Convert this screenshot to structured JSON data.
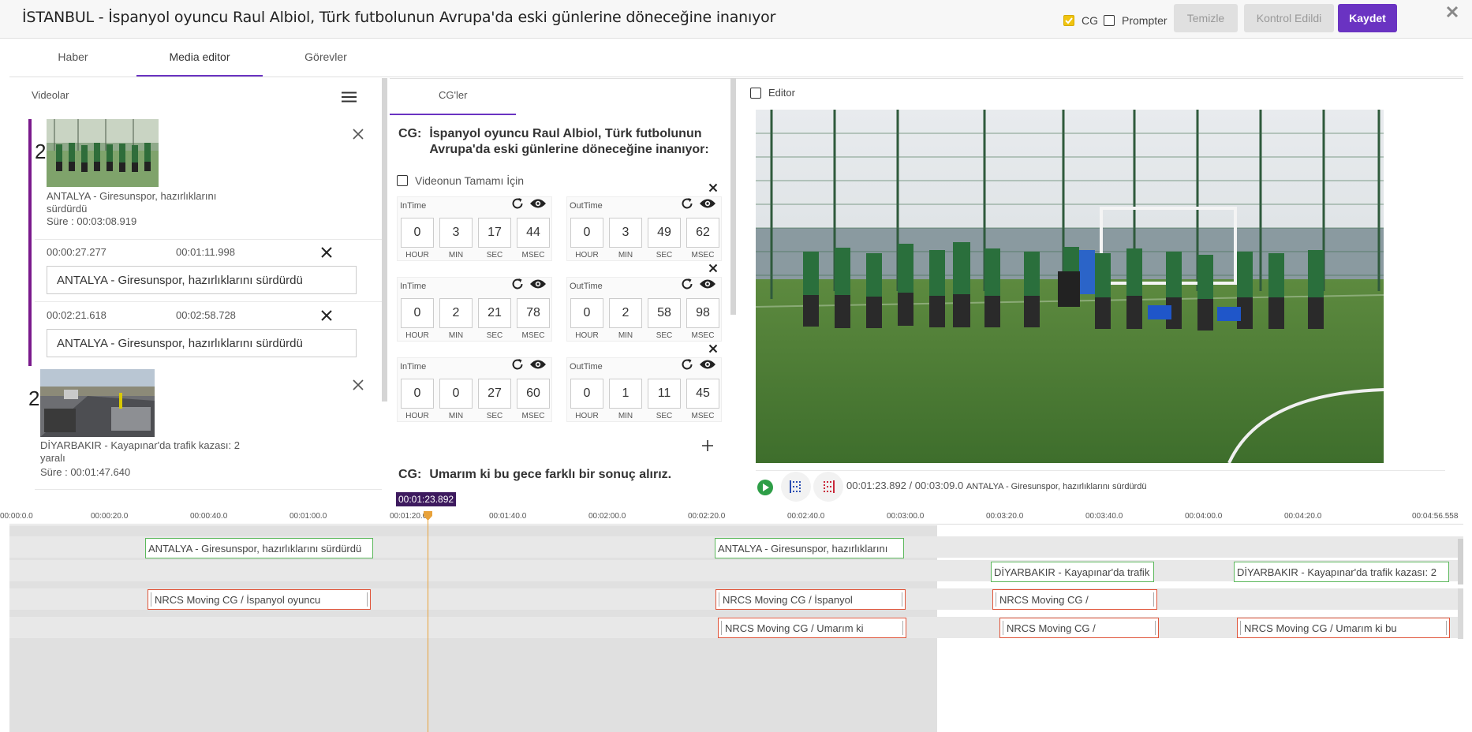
{
  "header": {
    "title": "İSTANBUL - İspanyol oyuncu Raul Albiol, Türk futbolunun Avrupa'da eski günlerine döneceğine inanıyor",
    "cg_label": "CG",
    "prompter_label": "Prompter",
    "clear_label": "Temizle",
    "checked_label": "Kontrol Edildi",
    "save_label": "Kaydet",
    "cg_checked": true,
    "prompter_checked": false
  },
  "tabs": [
    {
      "label": "Haber",
      "active": false
    },
    {
      "label": "Media editor",
      "active": true
    },
    {
      "label": "Görevler",
      "active": false
    }
  ],
  "videos_panel": {
    "title": "Videolar",
    "videos": [
      {
        "index": "2",
        "title": "ANTALYA - Giresunspor, hazırlıklarını sürdürdü",
        "duration_label": "Süre :",
        "duration": "00:03:08.919",
        "segments": [
          {
            "start": "00:00:27.277",
            "end": "00:01:11.998",
            "text": "ANTALYA - Giresunspor, hazırlıklarını sürdürdü"
          },
          {
            "start": "00:02:21.618",
            "end": "00:02:58.728",
            "text": "ANTALYA - Giresunspor, hazırlıklarını sürdürdü"
          }
        ]
      },
      {
        "index": "2",
        "title": "DİYARBAKIR - Kayapınar'da trafik kazası: 2 yaralı",
        "duration_label": "Süre :",
        "duration": "00:01:47.640"
      }
    ]
  },
  "cg_panel": {
    "tab_label": "CG'ler",
    "cg_prefix": "CG:",
    "cg_text": "İspanyol oyuncu Raul Albiol, Türk futbolunun Avrupa'da eski günlerine döneceğine inanıyor:",
    "full_video_label": "Videonun Tamamı İçin",
    "in_label": "InTime",
    "out_label": "OutTime",
    "unit_labels": [
      "HOUR",
      "MIN",
      "SEC",
      "MSEC"
    ],
    "timings": [
      {
        "in": [
          "0",
          "3",
          "17",
          "44"
        ],
        "out": [
          "0",
          "3",
          "49",
          "62"
        ]
      },
      {
        "in": [
          "0",
          "2",
          "21",
          "78"
        ],
        "out": [
          "0",
          "2",
          "58",
          "98"
        ]
      },
      {
        "in": [
          "0",
          "0",
          "27",
          "60"
        ],
        "out": [
          "0",
          "1",
          "11",
          "45"
        ]
      }
    ],
    "add_symbol": "+",
    "cg2_text": "Umarım ki bu gece farklı bir sonuç alırız."
  },
  "editor": {
    "label": "Editor",
    "checked": false,
    "player_time": "00:01:23.892 / 00:03:09.0",
    "player_clip_title": "ANTALYA - Giresunspor, hazırlıklarını sürdürdü"
  },
  "timeline": {
    "playhead_label": "00:01:23.892",
    "ticks": [
      "00:00:0.0",
      "00:00:20.0",
      "00:00:40.0",
      "00:01:00.0",
      "00:01:20.0",
      "00:01:40.0",
      "00:02:00.0",
      "00:02:20.0",
      "00:02:40.0",
      "00:03:00.0",
      "00:03:20.0",
      "00:03:40.0",
      "00:04:00.0",
      "00:04:20.0",
      "00:04:56.558"
    ],
    "clips": {
      "video1_a": "ANTALYA - Giresunspor, hazırlıklarını sürdürdü",
      "video1_b": "ANTALYA - Giresunspor, hazırlıklarını",
      "video2_a": "DİYARBAKIR - Kayapınar'da trafik",
      "video2_b": "DİYARBAKIR - Kayapınar'da trafik kazası: 2",
      "cg1_a": "NRCS Moving CG / İspanyol oyuncu",
      "cg1_b": "NRCS Moving CG / İspanyol",
      "cg1_c": "NRCS Moving CG /",
      "cg2_a": "NRCS Moving CG / Umarım ki",
      "cg2_b": "NRCS Moving CG /",
      "cg2_c": "NRCS Moving CG / Umarım ki bu"
    }
  },
  "colors": {
    "accent": "#6a33c2",
    "video_clip_border": "#5cb85c",
    "cg_clip_border": "#e0553a",
    "playhead": "#e8a23a",
    "cg_checkbox": "#f1c40f"
  }
}
